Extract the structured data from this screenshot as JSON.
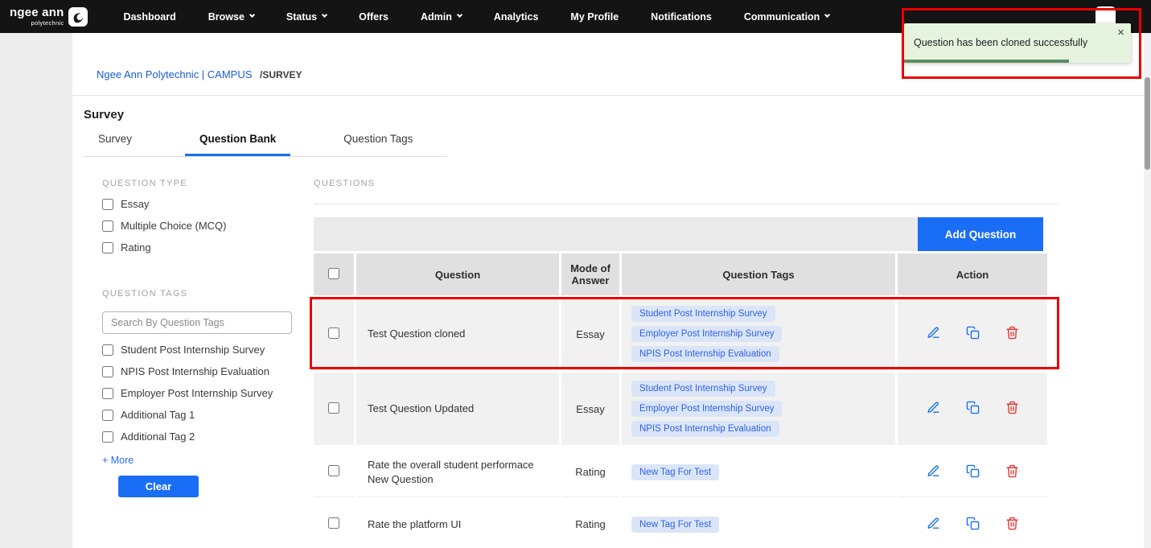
{
  "nav": {
    "logo_line1": "ngee ann",
    "logo_line2": "polytechnic",
    "items": [
      {
        "label": "Dashboard",
        "dropdown": false
      },
      {
        "label": "Browse",
        "dropdown": true
      },
      {
        "label": "Status",
        "dropdown": true
      },
      {
        "label": "Offers",
        "dropdown": false
      },
      {
        "label": "Admin",
        "dropdown": true
      },
      {
        "label": "Analytics",
        "dropdown": false
      },
      {
        "label": "My Profile",
        "dropdown": false
      },
      {
        "label": "Notifications",
        "dropdown": false
      },
      {
        "label": "Communication",
        "dropdown": true
      }
    ]
  },
  "toast": {
    "message": "Question has been cloned successfully",
    "close_icon": "×"
  },
  "breadcrumb": {
    "root": "Ngee Ann Polytechnic | CAMPUS",
    "current": "/SURVEY"
  },
  "page": {
    "title": "Survey"
  },
  "tabs": [
    {
      "label": "Survey",
      "active": false
    },
    {
      "label": "Question Bank",
      "active": true
    },
    {
      "label": "Question Tags",
      "active": false
    }
  ],
  "filters": {
    "question_type": {
      "label": "QUESTION TYPE",
      "options": [
        "Essay",
        "Multiple Choice (MCQ)",
        "Rating"
      ]
    },
    "question_tags": {
      "label": "QUESTION TAGS",
      "search_placeholder": "Search By Question Tags",
      "options": [
        "Student Post Internship Survey",
        "NPIS Post Internship Evaluation",
        "Employer Post Internship Survey",
        "Additional Tag 1",
        "Additional Tag 2"
      ],
      "more_label": "+ More",
      "clear_label": "Clear"
    }
  },
  "questions": {
    "section_label": "QUESTIONS",
    "add_button": "Add Question",
    "columns": [
      "Question",
      "Mode of Answer",
      "Question Tags",
      "Action"
    ],
    "rows": [
      {
        "question": "Test Question cloned",
        "mode": "Essay",
        "tags": [
          "Student Post Internship Survey",
          "Employer Post Internship Survey",
          "NPIS Post Internship Evaluation"
        ],
        "highlighted": true
      },
      {
        "question": "Test Question Updated",
        "mode": "Essay",
        "tags": [
          "Student Post Internship Survey",
          "Employer Post Internship Survey",
          "NPIS Post Internship Evaluation"
        ],
        "highlighted": false
      },
      {
        "question": "Rate the overall student performace New Question",
        "mode": "Rating",
        "tags": [
          "New Tag For Test"
        ],
        "highlighted": false
      },
      {
        "question": "Rate the platform UI",
        "mode": "Rating",
        "tags": [
          "New Tag For Test"
        ],
        "highlighted": false
      }
    ]
  },
  "colors": {
    "accent_blue": "#1a6ef5",
    "tab_underline_blue": "#1a73e8",
    "tag_pill_bg": "#dbe5f8",
    "tag_pill_text": "#2c63e8",
    "toast_bg_green": "#e5f3df",
    "toast_progress_green": "#5f8d5f",
    "delete_red": "#e53935",
    "annotation_red": "#ec0000",
    "nav_black": "#141414"
  }
}
